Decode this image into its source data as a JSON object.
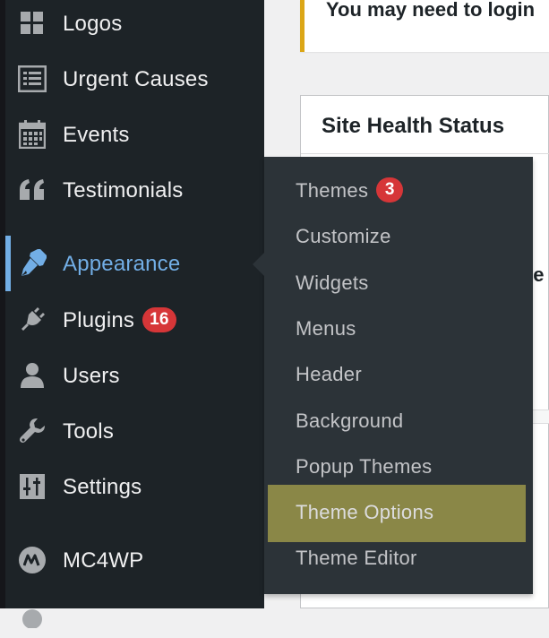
{
  "sidebar": {
    "items": [
      {
        "label": "Logos",
        "icon": "grid-icon"
      },
      {
        "label": "Urgent Causes",
        "icon": "list-icon"
      },
      {
        "label": "Events",
        "icon": "calendar-icon"
      },
      {
        "label": "Testimonials",
        "icon": "quote-icon"
      },
      {
        "label": "Appearance",
        "icon": "paintbrush-icon"
      },
      {
        "label": "Plugins",
        "icon": "plug-icon",
        "badge": "16"
      },
      {
        "label": "Users",
        "icon": "user-icon"
      },
      {
        "label": "Tools",
        "icon": "wrench-icon"
      },
      {
        "label": "Settings",
        "icon": "sliders-icon"
      },
      {
        "label": "MC4WP",
        "icon": "mc4wp-icon"
      },
      {
        "label": "",
        "icon": ""
      }
    ],
    "active": "Appearance"
  },
  "submenu": {
    "items": [
      {
        "label": "Themes",
        "badge": "3"
      },
      {
        "label": "Customize"
      },
      {
        "label": "Widgets"
      },
      {
        "label": "Menus"
      },
      {
        "label": "Header"
      },
      {
        "label": "Background"
      },
      {
        "label": "Popup Themes"
      },
      {
        "label": "Theme Options",
        "highlighted": true
      },
      {
        "label": "Theme Editor"
      }
    ]
  },
  "notice": {
    "text": "You may need to login"
  },
  "panel": {
    "title": "Site Health Status",
    "fragment": "ve"
  },
  "colors": {
    "sidebar_bg": "#1d2327",
    "submenu_bg": "#2c3338",
    "accent": "#72aee6",
    "badge": "#d63638",
    "highlight": "#8a8747",
    "notice_border": "#dba617"
  }
}
